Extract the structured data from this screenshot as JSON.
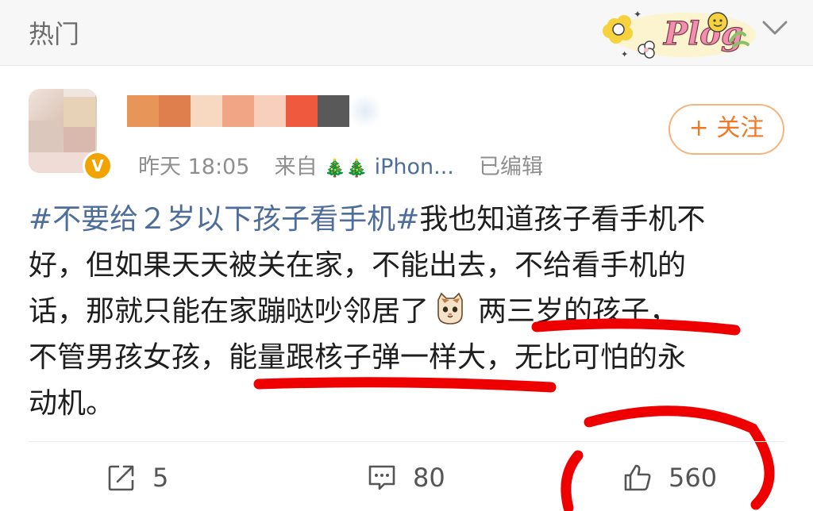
{
  "topbar": {
    "title": "热门",
    "sticker_text": "Plog",
    "chevron_icon": "chevron-down-icon"
  },
  "post": {
    "avatar_icon": "avatar",
    "verified_badge": "V",
    "meta": {
      "time": "昨天 18:05",
      "from_label": "来自",
      "source": "iPhon...",
      "edited": "已编辑"
    },
    "follow_label": "+ 关注",
    "body_lines": [
      {
        "hashtag": "#不要给２岁以下孩子看手机#",
        "text": "我也知道孩子看手机不"
      },
      {
        "text": "好，但如果天天被关在家，不能出去，不给看手机的"
      },
      {
        "text_before": "话，那就只能在家蹦哒吵邻居了",
        "text_after": "两三岁的孩子，"
      },
      {
        "text": "不管男孩女孩，能量跟核子弹一样大，无比可怕的永"
      },
      {
        "text": "动机。"
      }
    ],
    "marker_color": "#ee0000"
  },
  "actions": {
    "share_count": "5",
    "comment_count": "80",
    "like_count": "560"
  }
}
